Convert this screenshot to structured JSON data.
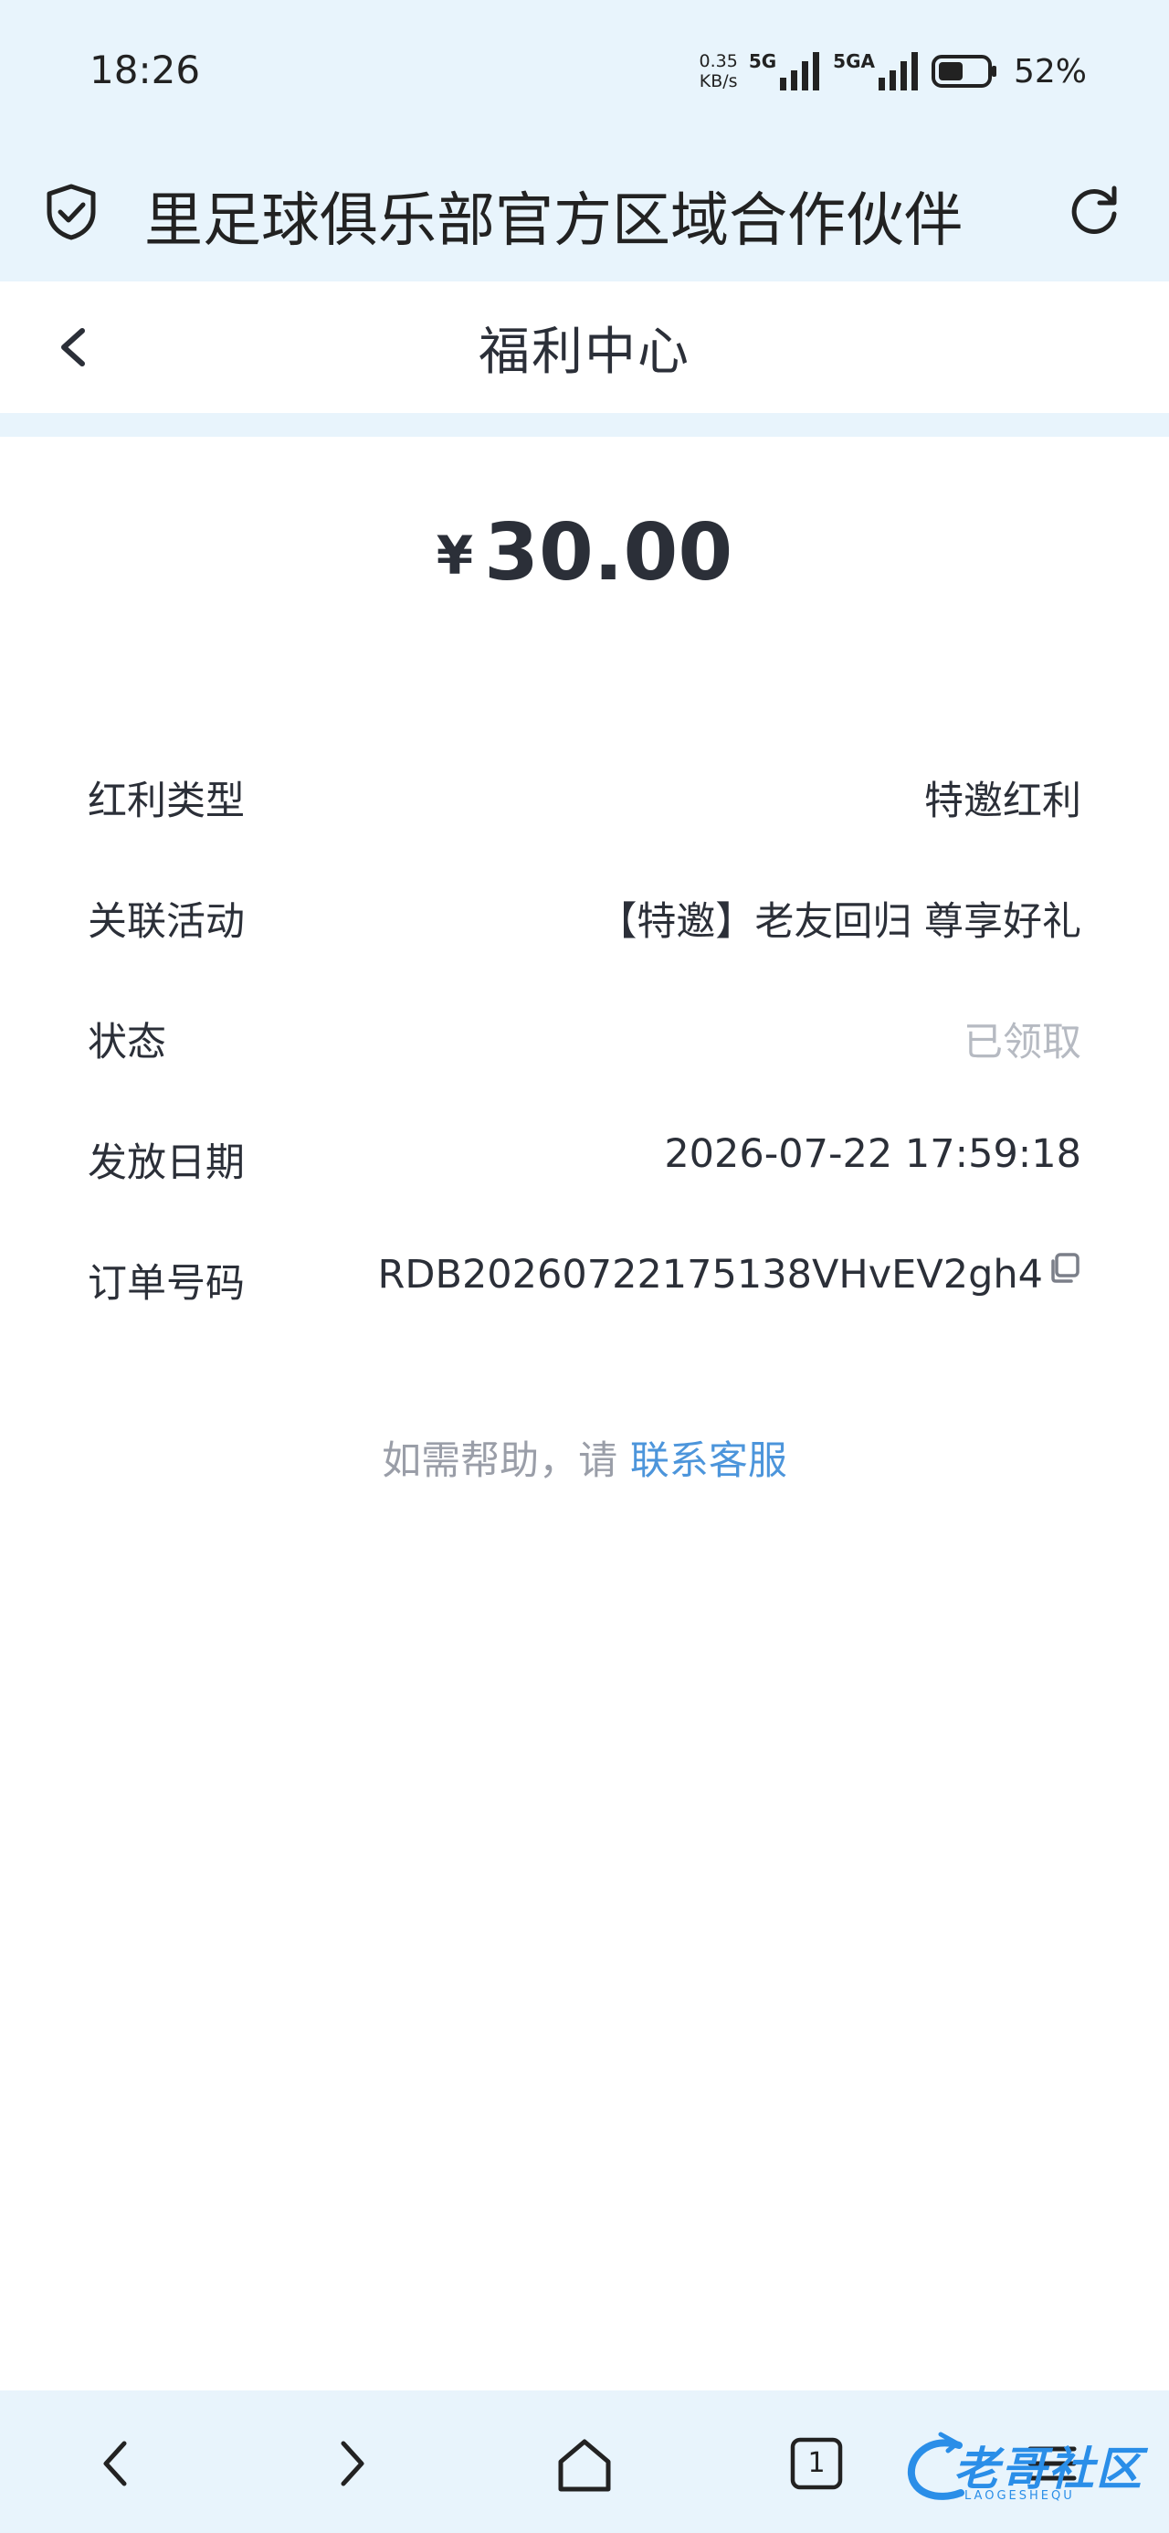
{
  "status_bar": {
    "time": "18:26",
    "net_speed_value": "0.35",
    "net_speed_unit": "KB/s",
    "net_type_1": "5G",
    "net_type_2": "5GA",
    "battery_pct": "52%",
    "battery_level": 0.52
  },
  "browser": {
    "url_text": "里足球俱乐部官方区域合作伙伴",
    "shield_icon": "shield-check-icon",
    "refresh_icon": "refresh-icon"
  },
  "header": {
    "title": "福利中心",
    "back_icon": "chevron-left-icon"
  },
  "amount": {
    "currency": "¥",
    "value": "30.00"
  },
  "details": [
    {
      "label": "红利类型",
      "value": "特邀红利"
    },
    {
      "label": "关联活动",
      "value": "【特邀】老友回归 尊享好礼"
    },
    {
      "label": "状态",
      "value": "已领取"
    },
    {
      "label": "发放日期",
      "value": "2026-07-22 17:59:18"
    },
    {
      "label": "订单号码",
      "value": "RDB20260722175138VHvEV2gh4"
    }
  ],
  "help": {
    "prefix": "如需帮助，请",
    "link": "联系客服"
  },
  "bottom_nav": {
    "tab_count": "1",
    "icons": [
      "back-icon",
      "forward-icon",
      "home-icon",
      "tabs-icon",
      "menu-icon"
    ]
  },
  "watermark": {
    "text": "老哥社区",
    "sub": "LAOGESHEQU"
  },
  "colors": {
    "chrome_bg": "#e8f4fc",
    "text_primary": "#2b2f38",
    "text_muted": "#b6bac2",
    "link": "#4c95db"
  }
}
